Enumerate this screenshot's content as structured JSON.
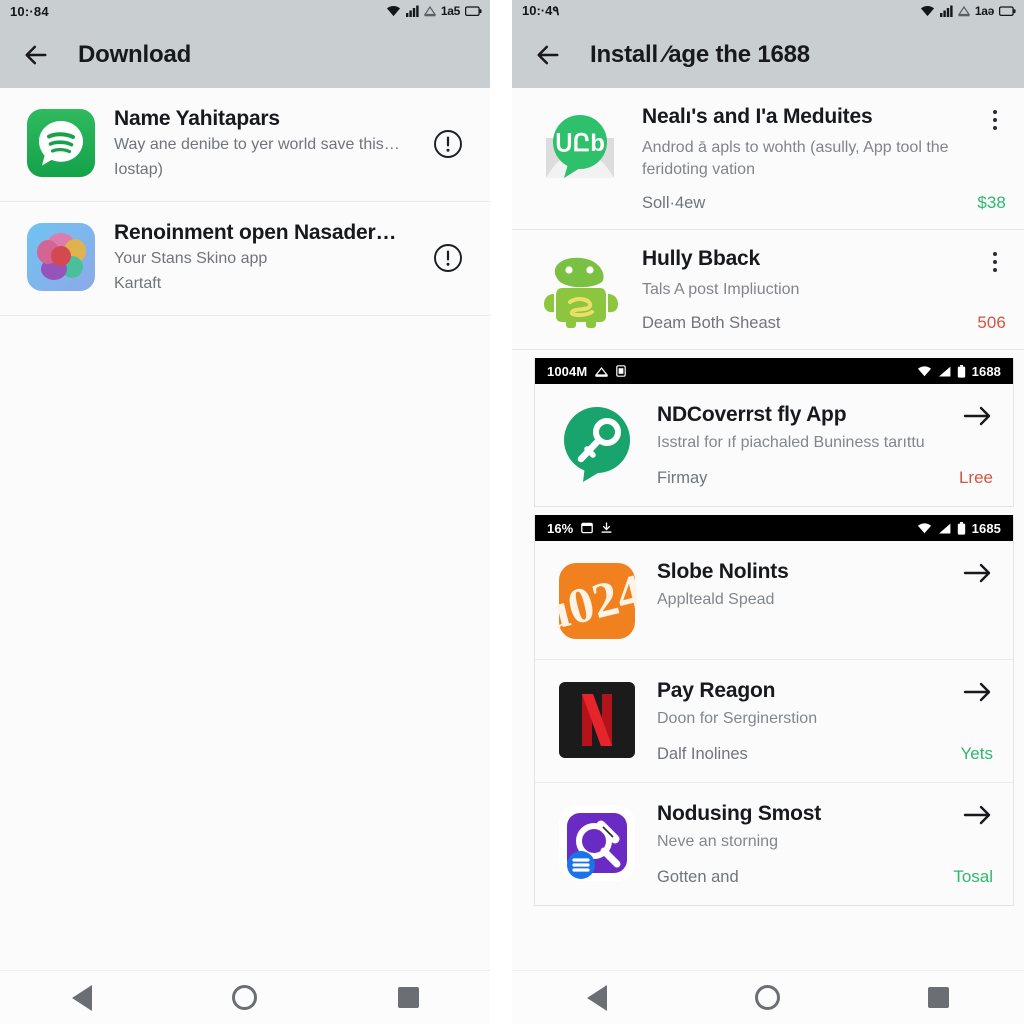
{
  "left_panel": {
    "status_bar": {
      "time": "10:·84",
      "battery_text": "1a5",
      "icons": [
        "wifi-icon",
        "signal-icon",
        "sim-icon",
        "battery-icon"
      ]
    },
    "app_bar": {
      "back_icon": "back-arrow-icon",
      "title": "Download"
    },
    "items": [
      {
        "icon": "spotify-chat-icon",
        "title": "Name Yahitapars",
        "subtitle": "Way ane denibe to yer world save this…",
        "subtitle2": "Iostap)",
        "action_icon": "info-circle-icon"
      },
      {
        "icon": "photos-petals-icon",
        "title": "Renoinment open Nasader…",
        "subtitle": "Your Stans Skino app",
        "subtitle2": "Kartaft",
        "action_icon": "info-circle-icon"
      }
    ],
    "nav": {
      "back": "nav-back-icon",
      "home": "nav-home-icon",
      "recents": "nav-recents-icon"
    }
  },
  "right_panel": {
    "status_bar": {
      "time": "10:·4٩",
      "battery_text": "1aə",
      "icons": [
        "wifi-icon",
        "signal-icon",
        "sim-icon",
        "battery-icon"
      ]
    },
    "app_bar": {
      "back_icon": "back-arrow-icon",
      "title": "Install ⁄age the 1688"
    },
    "items": [
      {
        "icon": "whatsapp-bubble-icon",
        "title": "Nealı's and I'a Meduites",
        "description": "Androd ā apls to wohth (asully, App tool the feridoting vation",
        "meta": "Soll·4ew",
        "price": "$38",
        "price_color": "#2eb872",
        "action_icon": "kebab-menu-icon"
      },
      {
        "icon": "android-mascot-icon",
        "title": "Hully Bback",
        "description": "Tals A post Impliuction",
        "meta": "Deam Both Sheast",
        "price": "506",
        "price_color": "#d2553f",
        "action_icon": "kebab-menu-icon"
      }
    ],
    "cards": [
      {
        "status_bar": {
          "left_text": "1004M",
          "left_icons": [
            "cast-icon",
            "sim-card-icon"
          ],
          "right_text": "1688",
          "right_icons": [
            "wifi-icon",
            "signal-icon",
            "battery-icon"
          ]
        },
        "rows": [
          {
            "icon": "key-bubble-icon",
            "title": "NDCoverrst fly App",
            "description": "Isstral for ıf piachaled Buniness tarıttu",
            "meta": "Firmay",
            "price": "Lree",
            "price_color": "#d2553f",
            "action_icon": "arrow-right-icon"
          }
        ]
      },
      {
        "status_bar": {
          "left_text": "16%",
          "left_icons": [
            "sim-card-icon",
            "download-icon"
          ],
          "right_text": "1685",
          "right_icons": [
            "wifi-icon",
            "signal-icon",
            "battery-icon"
          ]
        },
        "rows": [
          {
            "icon": "bitcoin-orange-icon",
            "title": "Slobe Nolints",
            "description": "Applteald Spead",
            "meta": "",
            "price": "",
            "price_color": "#2eb872",
            "action_icon": "arrow-right-icon"
          },
          {
            "icon": "netflix-icon",
            "title": "Pay Reagon",
            "description": "Doon for Serginerstion",
            "meta": "Dalf Inolines",
            "price": "Yets",
            "price_color": "#2eb872",
            "action_icon": "arrow-right-icon"
          },
          {
            "icon": "purple-search-chat-icon",
            "title": "Nodusing Smost",
            "description": "Neve an storning",
            "meta": "Gotten and",
            "price": "Tosal",
            "price_color": "#2eb872",
            "action_icon": "arrow-right-icon"
          }
        ]
      }
    ],
    "nav": {
      "back": "nav-back-icon",
      "home": "nav-home-icon",
      "recents": "nav-recents-icon"
    }
  }
}
